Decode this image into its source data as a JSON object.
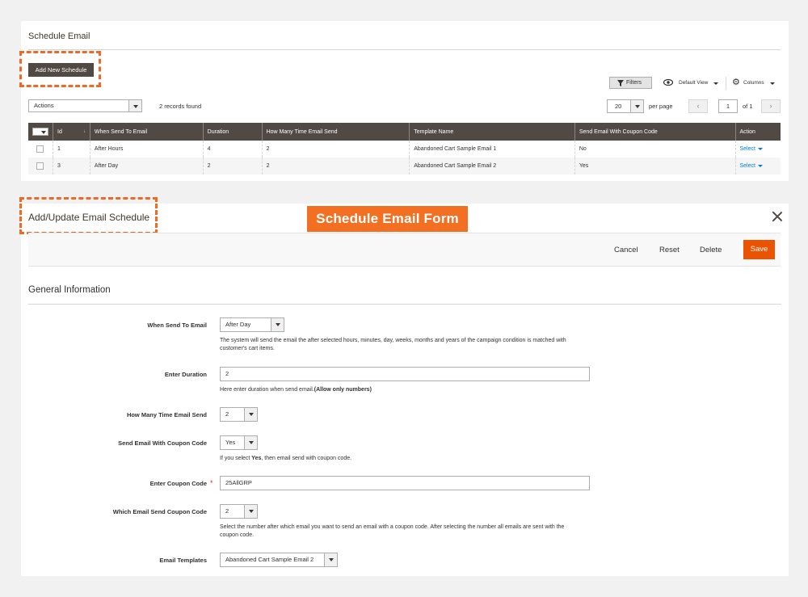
{
  "grid": {
    "title": "Schedule Email",
    "add_button": "Add New Schedule",
    "filters_label": "Filters",
    "view_label": "Default View",
    "columns_label": "Columns",
    "actions_select": "Actions",
    "records_found": "2 records found",
    "per_page_value": "20",
    "per_page_label": "per page",
    "page_current": "1",
    "page_of": "of 1",
    "columns": [
      "Id",
      "When Send To Email",
      "Duration",
      "How Many Time Email Send",
      "Template Name",
      "Send Email With Coupon Code",
      "Action"
    ],
    "rows": [
      {
        "id": "1",
        "when": "After Hours",
        "duration": "4",
        "times": "2",
        "template": "Abandoned Cart Sample Email 1",
        "coupon": "No",
        "action": "Select"
      },
      {
        "id": "3",
        "when": "After Day",
        "duration": "2",
        "times": "2",
        "template": "Abandoned Cart Sample Email 2",
        "coupon": "Yes",
        "action": "Select"
      }
    ]
  },
  "form": {
    "title": "Add/Update Email Schedule",
    "badge": "Schedule Email Form",
    "cancel": "Cancel",
    "reset": "Reset",
    "delete": "Delete",
    "save": "Save",
    "section": "General Information",
    "fields": {
      "when_label": "When Send To Email",
      "when_value": "After Day",
      "when_note": "The system will send the email the after selected hours, minutes, day, weeks, months and years of the campaign condition is matched with customer's cart items.",
      "duration_label": "Enter Duration",
      "duration_value": "2",
      "duration_note": "Here enter duration when send email.",
      "duration_note_bold": "(Allow only numbers)",
      "times_label": "How Many Time Email Send",
      "times_value": "2",
      "coupon_label": "Send Email With Coupon Code",
      "coupon_value": "Yes",
      "coupon_note_a": "If you select ",
      "coupon_note_b": "Yes",
      "coupon_note_c": ", then email send with coupon code.",
      "code_label": "Enter Coupon Code",
      "code_value": "25AllGRP",
      "which_label": "Which Email Send Coupon Code",
      "which_value": "2",
      "which_note": "Select the number after which email you want to send an email with a coupon code. After selecting the number all emails are sent with the coupon code.",
      "templates_label": "Email Templates",
      "templates_value": "Abandoned Cart Sample Email 2"
    }
  },
  "colors": {
    "accent_orange": "#eb5202",
    "header_dark": "#514943",
    "link_blue": "#007bdb"
  }
}
